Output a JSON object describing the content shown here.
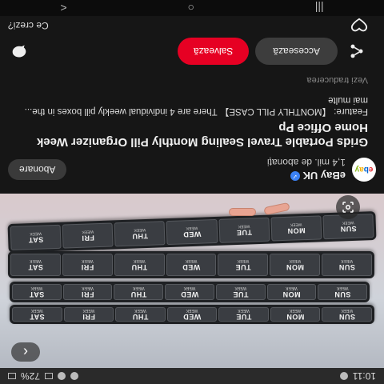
{
  "status_bar": {
    "time": "10:11",
    "battery": "72%"
  },
  "hero": {
    "back_glyph": "‹",
    "organizer_days": [
      "SUN",
      "MON",
      "TUE",
      "WED",
      "THU",
      "FRI",
      "SAT"
    ],
    "week_label": "WEEK",
    "lens_icon": "lens-icon"
  },
  "seller": {
    "avatar_text": [
      "e",
      "b",
      "a",
      "y"
    ],
    "name": "eBay UK",
    "followers": "1,4 mil. de abonați",
    "subscribe_label": "Abonare"
  },
  "pin": {
    "title": "Grids Portable Travel Sealing Monthly Pill Organizer Week Home Office Pp",
    "description": "Feature: 【MONTHLY PILL CASE】 There are 4 individual weekly pill boxes in the... mai multe",
    "translate_label": "Vezi traducerea"
  },
  "actions": {
    "visit_label": "Accesează",
    "save_label": "Salvează"
  },
  "reaction": {
    "question": "Ce crezi?"
  },
  "nav": {
    "recents": "|||",
    "home": "○",
    "back": "<"
  },
  "colors": {
    "save_button": "#e60023",
    "accent_blue": "#3b82f6"
  }
}
